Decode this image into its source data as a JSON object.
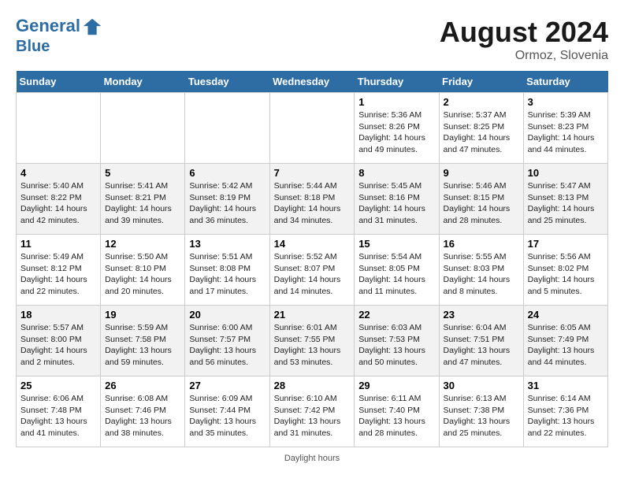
{
  "header": {
    "logo_line1": "General",
    "logo_line2": "Blue",
    "month": "August 2024",
    "location": "Ormoz, Slovenia"
  },
  "days_of_week": [
    "Sunday",
    "Monday",
    "Tuesday",
    "Wednesday",
    "Thursday",
    "Friday",
    "Saturday"
  ],
  "weeks": [
    [
      {
        "day": "",
        "info": ""
      },
      {
        "day": "",
        "info": ""
      },
      {
        "day": "",
        "info": ""
      },
      {
        "day": "",
        "info": ""
      },
      {
        "day": "1",
        "info": "Sunrise: 5:36 AM\nSunset: 8:26 PM\nDaylight: 14 hours\nand 49 minutes."
      },
      {
        "day": "2",
        "info": "Sunrise: 5:37 AM\nSunset: 8:25 PM\nDaylight: 14 hours\nand 47 minutes."
      },
      {
        "day": "3",
        "info": "Sunrise: 5:39 AM\nSunset: 8:23 PM\nDaylight: 14 hours\nand 44 minutes."
      }
    ],
    [
      {
        "day": "4",
        "info": "Sunrise: 5:40 AM\nSunset: 8:22 PM\nDaylight: 14 hours\nand 42 minutes."
      },
      {
        "day": "5",
        "info": "Sunrise: 5:41 AM\nSunset: 8:21 PM\nDaylight: 14 hours\nand 39 minutes."
      },
      {
        "day": "6",
        "info": "Sunrise: 5:42 AM\nSunset: 8:19 PM\nDaylight: 14 hours\nand 36 minutes."
      },
      {
        "day": "7",
        "info": "Sunrise: 5:44 AM\nSunset: 8:18 PM\nDaylight: 14 hours\nand 34 minutes."
      },
      {
        "day": "8",
        "info": "Sunrise: 5:45 AM\nSunset: 8:16 PM\nDaylight: 14 hours\nand 31 minutes."
      },
      {
        "day": "9",
        "info": "Sunrise: 5:46 AM\nSunset: 8:15 PM\nDaylight: 14 hours\nand 28 minutes."
      },
      {
        "day": "10",
        "info": "Sunrise: 5:47 AM\nSunset: 8:13 PM\nDaylight: 14 hours\nand 25 minutes."
      }
    ],
    [
      {
        "day": "11",
        "info": "Sunrise: 5:49 AM\nSunset: 8:12 PM\nDaylight: 14 hours\nand 22 minutes."
      },
      {
        "day": "12",
        "info": "Sunrise: 5:50 AM\nSunset: 8:10 PM\nDaylight: 14 hours\nand 20 minutes."
      },
      {
        "day": "13",
        "info": "Sunrise: 5:51 AM\nSunset: 8:08 PM\nDaylight: 14 hours\nand 17 minutes."
      },
      {
        "day": "14",
        "info": "Sunrise: 5:52 AM\nSunset: 8:07 PM\nDaylight: 14 hours\nand 14 minutes."
      },
      {
        "day": "15",
        "info": "Sunrise: 5:54 AM\nSunset: 8:05 PM\nDaylight: 14 hours\nand 11 minutes."
      },
      {
        "day": "16",
        "info": "Sunrise: 5:55 AM\nSunset: 8:03 PM\nDaylight: 14 hours\nand 8 minutes."
      },
      {
        "day": "17",
        "info": "Sunrise: 5:56 AM\nSunset: 8:02 PM\nDaylight: 14 hours\nand 5 minutes."
      }
    ],
    [
      {
        "day": "18",
        "info": "Sunrise: 5:57 AM\nSunset: 8:00 PM\nDaylight: 14 hours\nand 2 minutes."
      },
      {
        "day": "19",
        "info": "Sunrise: 5:59 AM\nSunset: 7:58 PM\nDaylight: 13 hours\nand 59 minutes."
      },
      {
        "day": "20",
        "info": "Sunrise: 6:00 AM\nSunset: 7:57 PM\nDaylight: 13 hours\nand 56 minutes."
      },
      {
        "day": "21",
        "info": "Sunrise: 6:01 AM\nSunset: 7:55 PM\nDaylight: 13 hours\nand 53 minutes."
      },
      {
        "day": "22",
        "info": "Sunrise: 6:03 AM\nSunset: 7:53 PM\nDaylight: 13 hours\nand 50 minutes."
      },
      {
        "day": "23",
        "info": "Sunrise: 6:04 AM\nSunset: 7:51 PM\nDaylight: 13 hours\nand 47 minutes."
      },
      {
        "day": "24",
        "info": "Sunrise: 6:05 AM\nSunset: 7:49 PM\nDaylight: 13 hours\nand 44 minutes."
      }
    ],
    [
      {
        "day": "25",
        "info": "Sunrise: 6:06 AM\nSunset: 7:48 PM\nDaylight: 13 hours\nand 41 minutes."
      },
      {
        "day": "26",
        "info": "Sunrise: 6:08 AM\nSunset: 7:46 PM\nDaylight: 13 hours\nand 38 minutes."
      },
      {
        "day": "27",
        "info": "Sunrise: 6:09 AM\nSunset: 7:44 PM\nDaylight: 13 hours\nand 35 minutes."
      },
      {
        "day": "28",
        "info": "Sunrise: 6:10 AM\nSunset: 7:42 PM\nDaylight: 13 hours\nand 31 minutes."
      },
      {
        "day": "29",
        "info": "Sunrise: 6:11 AM\nSunset: 7:40 PM\nDaylight: 13 hours\nand 28 minutes."
      },
      {
        "day": "30",
        "info": "Sunrise: 6:13 AM\nSunset: 7:38 PM\nDaylight: 13 hours\nand 25 minutes."
      },
      {
        "day": "31",
        "info": "Sunrise: 6:14 AM\nSunset: 7:36 PM\nDaylight: 13 hours\nand 22 minutes."
      }
    ]
  ],
  "footer": {
    "note": "Daylight hours"
  }
}
